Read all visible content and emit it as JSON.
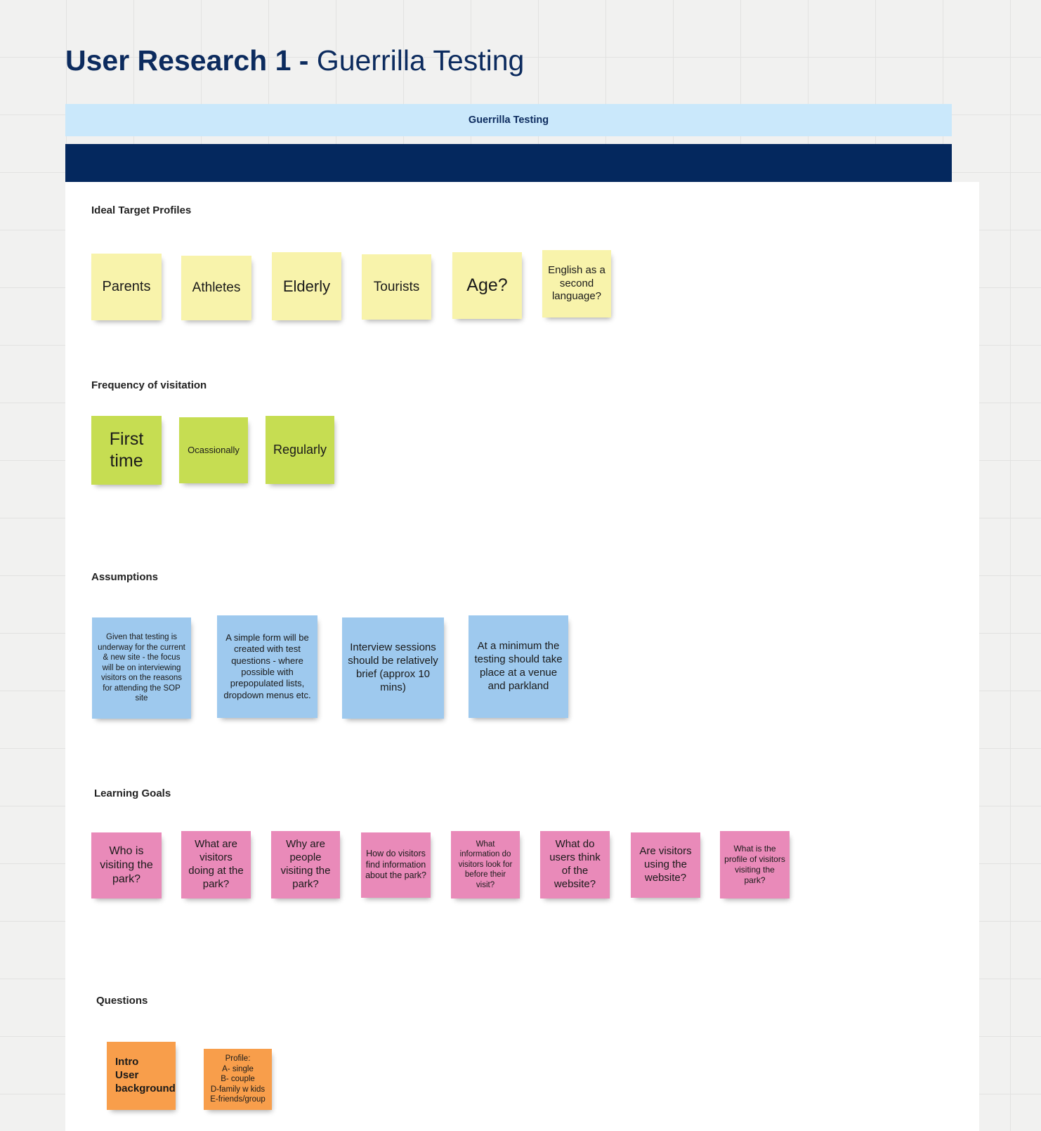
{
  "colors": {
    "navy": "#04285e",
    "light_blue_bar": "#cae8fb",
    "yellow_note": "#f8f3ab",
    "green_note": "#c6dd52",
    "blue_note": "#9ec9ee",
    "pink_note": "#e98ab9",
    "orange_note": "#f89e4b",
    "canvas": "#ffffff",
    "board_background": "#f1f1f0"
  },
  "title": {
    "strong": "User Research 1 - ",
    "light": "Guerrilla Testing"
  },
  "sheet_bar": {
    "label": "Guerrilla Testing"
  },
  "sections": {
    "ideal_target_profiles": {
      "heading": "Ideal Target Profiles",
      "notes": [
        {
          "text": "Parents"
        },
        {
          "text": "Athletes"
        },
        {
          "text": "Elderly"
        },
        {
          "text": "Tourists"
        },
        {
          "text": "Age?"
        },
        {
          "text": "English as a second language?"
        }
      ]
    },
    "frequency_of_visitation": {
      "heading": "Frequency of visitation",
      "notes": [
        {
          "text": "First time"
        },
        {
          "text": "Ocassionally"
        },
        {
          "text": "Regularly"
        }
      ]
    },
    "assumptions": {
      "heading": "Assumptions",
      "notes": [
        {
          "text": "Given that testing is underway for the current & new site - the focus will be on interviewing visitors on the reasons for attending the SOP site"
        },
        {
          "text": "A simple form will be created with test questions - where possible with prepopulated lists, dropdown menus etc."
        },
        {
          "text": "Interview sessions should be relatively brief (approx 10 mins)"
        },
        {
          "text": "At a minimum the testing should take place at a venue and parkland"
        }
      ]
    },
    "learning_goals": {
      "heading": "Learning Goals",
      "notes": [
        {
          "text": "Who is visiting the park?"
        },
        {
          "text": "What are visitors doing at the park?"
        },
        {
          "text": "Why are people visiting the park?"
        },
        {
          "text": "How do visitors find information about the park?"
        },
        {
          "text": "What information do visitors look for before their visit?"
        },
        {
          "text": "What do users think of the website?"
        },
        {
          "text": "Are visitors using the website?"
        },
        {
          "text": "What is the profile of visitors visiting the park?"
        }
      ]
    },
    "questions": {
      "heading": "Questions",
      "notes": [
        {
          "text": "Intro\nUser\nbackground"
        },
        {
          "text": "Profile:\nA- single\nB- couple\nD-family w kids\nE-friends/group"
        }
      ]
    }
  }
}
